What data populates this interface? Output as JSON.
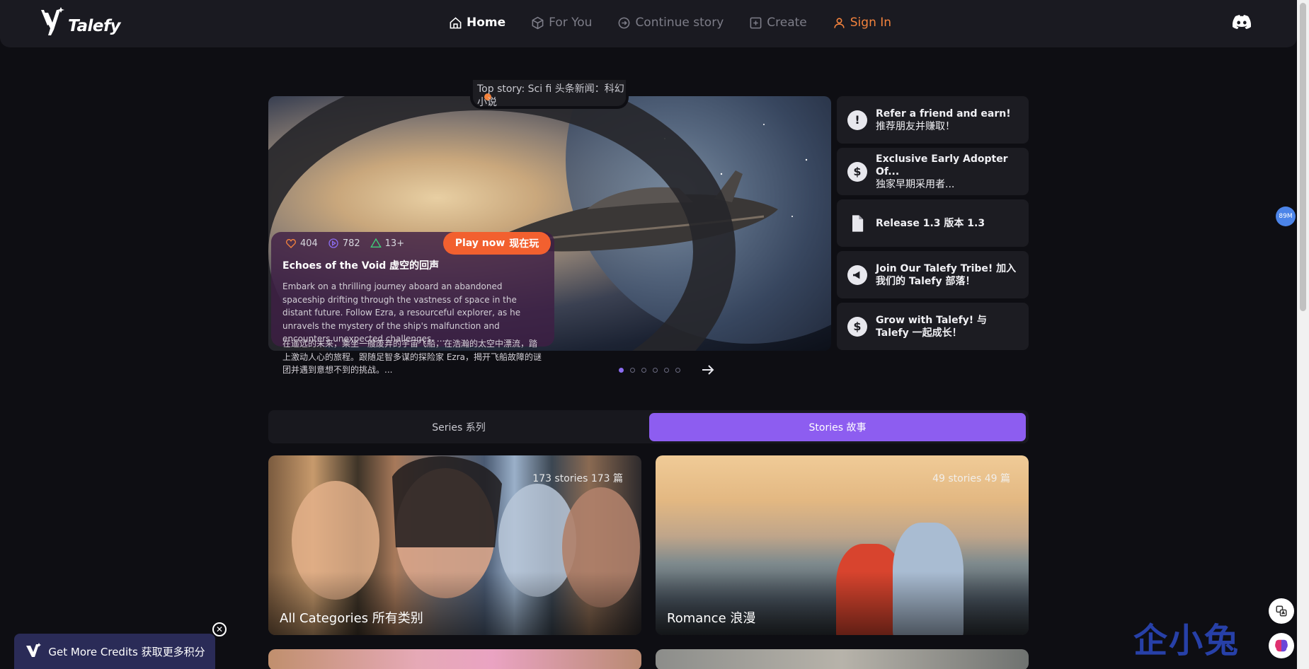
{
  "brand": {
    "name": "Talefy"
  },
  "nav": {
    "items": [
      {
        "label": "Home",
        "icon": "home-icon",
        "active": true
      },
      {
        "label": "For You",
        "icon": "box-icon",
        "active": false
      },
      {
        "label": "Continue story",
        "icon": "arrow-circle-icon",
        "active": false
      },
      {
        "label": "Create",
        "icon": "plus-square-icon",
        "active": false
      },
      {
        "label": "Sign In",
        "icon": "user-icon",
        "active": false
      }
    ],
    "discord_icon": "discord-icon"
  },
  "hero": {
    "top_story": "Top story: Sci fi 头条新闻：科幻小说",
    "stats": {
      "likes": "404",
      "plays": "782",
      "rating": "13+"
    },
    "play_label": "Play now",
    "play_label_cn": "现在玩",
    "title": "Echoes of the Void 虚空的回声",
    "description": "Embark on a thrilling journey aboard an abandoned spaceship drifting through the vastness of space in the distant future. Follow Ezra, a resourceful explorer, as he unravels the mystery of the ship's malfunction and encounters unexpected challenges. ...",
    "description_cn": "在遥远的未来，乘坐一艘废弃的宇宙飞船，在浩瀚的太空中漂流，踏上激动人心的旅程。跟随足智多谋的探险家 Ezra，揭开飞船故障的谜团并遇到意想不到的挑战。...",
    "carousel": {
      "total": 6,
      "active": 1
    }
  },
  "side": {
    "items": [
      {
        "line1": "Refer a friend and earn!",
        "line2": "推荐朋友并赚取！",
        "icon": "alert-badge-icon"
      },
      {
        "line1": "Exclusive Early Adopter Of...",
        "line2": "独家早期采用者...",
        "icon": "dollar-badge-icon"
      },
      {
        "line1": "Release 1.3 版本 1.3",
        "line2": "",
        "icon": "document-icon"
      },
      {
        "line1": "Join Our Talefy Tribe! 加入我们的 Talefy 部落！",
        "line2": "",
        "icon": "megaphone-icon"
      },
      {
        "line1": "Grow with Talefy! 与 Talefy 一起成长！",
        "line2": "",
        "icon": "dollar-badge-icon"
      }
    ]
  },
  "tabs": {
    "series": "Series 系列",
    "stories": "Stories 故事",
    "active": "stories"
  },
  "cards": [
    {
      "count": "173 stories 173 篇",
      "name": "All Categories 所有类别"
    },
    {
      "count": "49 stories 49 篇",
      "name": "Romance 浪漫"
    }
  ],
  "floating": {
    "credits_label": "Get More Credits  获取更多积分",
    "memory_badge": "89M",
    "watermark": "企小兔"
  },
  "colors": {
    "accent": "#8d5df0",
    "play": "#f2602f",
    "signin": "#f4833d",
    "bg": "#0e0e13"
  }
}
